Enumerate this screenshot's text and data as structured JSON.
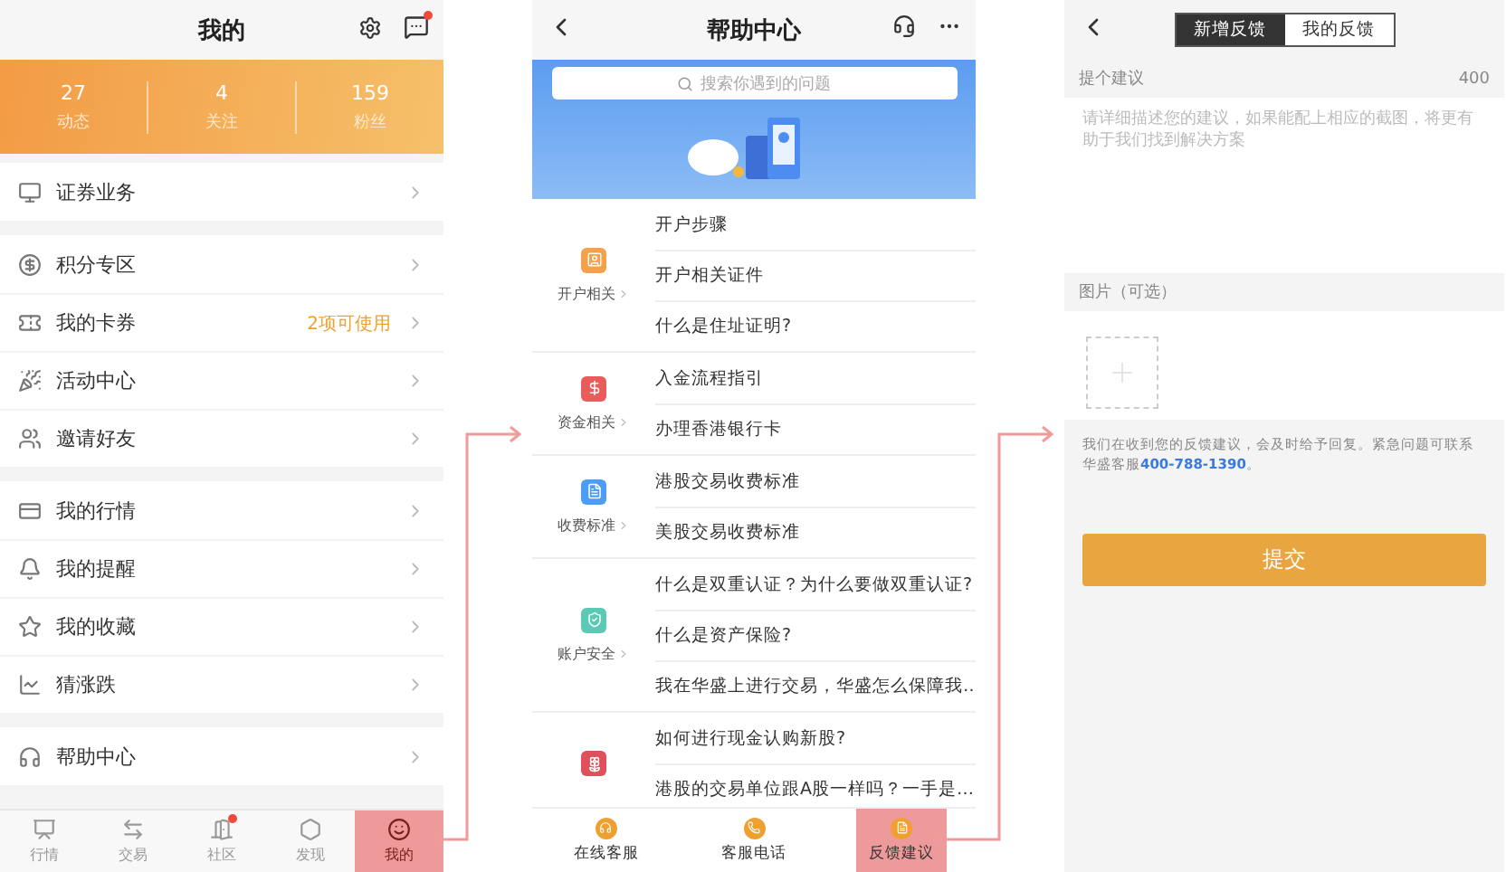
{
  "profile_screen": {
    "title": "我的",
    "message_unread": true,
    "stats": [
      {
        "value": "27",
        "label": "动态"
      },
      {
        "value": "4",
        "label": "关注"
      },
      {
        "value": "159",
        "label": "粉丝"
      }
    ],
    "menu_groups": [
      [
        {
          "label": "证券业务"
        }
      ],
      [
        {
          "label": "积分专区"
        },
        {
          "label": "我的卡券",
          "note": "2项可使用"
        },
        {
          "label": "活动中心"
        },
        {
          "label": "邀请好友"
        }
      ],
      [
        {
          "label": "我的行情"
        },
        {
          "label": "我的提醒"
        },
        {
          "label": "我的收藏"
        },
        {
          "label": "猜涨跌"
        }
      ],
      [
        {
          "label": "帮助中心"
        }
      ]
    ],
    "tabs": [
      {
        "label": "行情",
        "selected": false,
        "dot": false
      },
      {
        "label": "交易",
        "selected": false,
        "dot": false
      },
      {
        "label": "社区",
        "selected": false,
        "dot": true
      },
      {
        "label": "发现",
        "selected": false,
        "dot": false
      },
      {
        "label": "我的",
        "selected": true,
        "dot": false
      }
    ]
  },
  "help_screen": {
    "title": "帮助中心",
    "search": {
      "placeholder": "搜索你遇到的问题"
    },
    "categories": [
      {
        "label": "开户相关",
        "color": "#f5a04a",
        "questions": [
          "开户步骤",
          "开户相关证件",
          "什么是住址证明?"
        ]
      },
      {
        "label": "资金相关",
        "color": "#e85c5c",
        "questions": [
          "入金流程指引",
          "办理香港银行卡"
        ]
      },
      {
        "label": "收费标准",
        "color": "#4d9cf5",
        "questions": [
          "港股交易收费标准",
          "美股交易收费标准"
        ]
      },
      {
        "label": "账户安全",
        "color": "#5cc9b4",
        "questions": [
          "什么是双重认证？为什么要做双重认证?",
          "什么是资产保险?",
          "我在华盛上进行交易，华盛怎么保障我…"
        ]
      },
      {
        "color": "#e0505a",
        "questions": [
          "如何进行现金认购新股?",
          "港股的交易单位跟A股一样吗？一手是…"
        ]
      }
    ],
    "bottom_actions": [
      {
        "label": "在线客服",
        "selected": false
      },
      {
        "label": "客服电话",
        "selected": false
      },
      {
        "label": "反馈建议",
        "selected": true
      }
    ]
  },
  "feedback_screen": {
    "tabs": [
      {
        "label": "新增反馈",
        "selected": true
      },
      {
        "label": "我的反馈",
        "selected": false
      }
    ],
    "suggestion_label": "提个建议",
    "char_limit": "400",
    "suggestion": {
      "placeholder": "请详细描述您的建议，如果能配上相应的截图，将更有助于我们找到解决方案"
    },
    "image_label": "图片（可选）",
    "note": "我们在收到您的反馈建议，会及时给予回复。紧急问题可联系华盛客服",
    "note_link": "400-788-1390",
    "note_end": "。",
    "submit": "提交"
  }
}
